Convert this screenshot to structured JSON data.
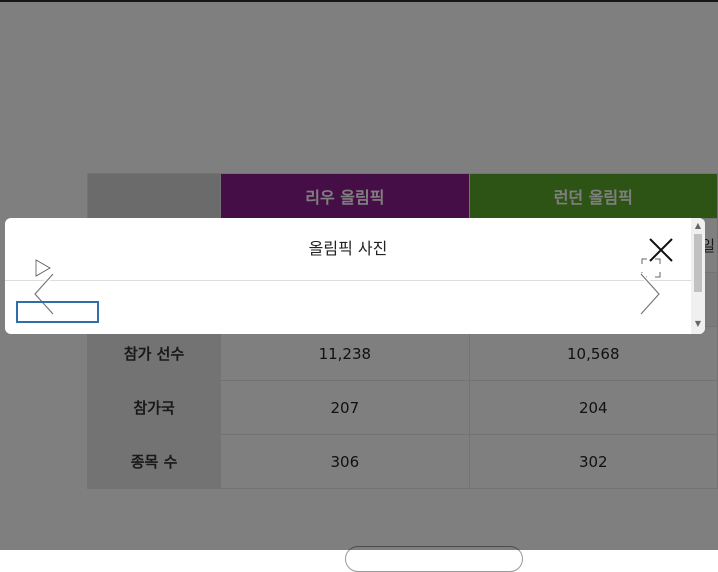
{
  "modal": {
    "title": "올림픽 사진"
  },
  "table": {
    "headers": [
      "",
      "리우 올림픽",
      "런던 올림픽"
    ],
    "peek_text": "일",
    "rows": [
      {
        "label": "참가 선수",
        "rio": "11,238",
        "london": "10,568"
      },
      {
        "label": "참가국",
        "rio": "207",
        "london": "204"
      },
      {
        "label": "종목 수",
        "rio": "306",
        "london": "302"
      }
    ]
  },
  "colors": {
    "rio_header": "#8b1c8e",
    "london_header": "#5aa62a",
    "focus_outline": "#2f6fa8"
  },
  "icons": {
    "close": "close-icon",
    "prev": "chevron-left-icon",
    "next": "chevron-right-icon",
    "play": "play-icon",
    "expand": "expand-icon"
  }
}
